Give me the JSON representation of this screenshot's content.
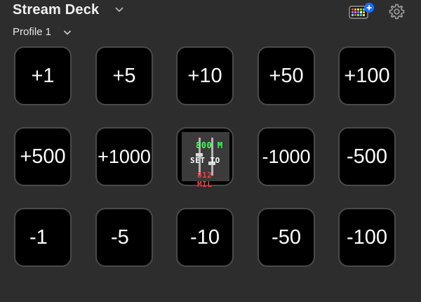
{
  "header": {
    "title": "Stream Deck",
    "title_chevron_icon": "chevron-down-icon",
    "device_icon": "keyboard-device-icon",
    "device_badge_icon": "plus-icon",
    "settings_icon": "gear-icon"
  },
  "profile": {
    "label": "Profile 1",
    "chevron_icon": "chevron-down-icon"
  },
  "keys": [
    {
      "label": "+1"
    },
    {
      "label": "+5"
    },
    {
      "label": "+10"
    },
    {
      "label": "+50"
    },
    {
      "label": "+100"
    },
    {
      "label": "+500"
    },
    {
      "label": "+1000"
    },
    {
      "image_lines": [
        "800 M",
        "SET TO",
        "812 MIL"
      ]
    },
    {
      "label": "-1000"
    },
    {
      "label": "-500"
    },
    {
      "label": "-1"
    },
    {
      "label": "-5"
    },
    {
      "label": "-10"
    },
    {
      "label": "-50"
    },
    {
      "label": "-100"
    }
  ],
  "colors": {
    "background": "#2d2d2d",
    "key_background": "#000000",
    "key_border": "#4a4a4a",
    "accent_blue": "#1e6fff",
    "set_top_green": "#42ff55",
    "set_bottom_red": "#ff3a3a"
  }
}
